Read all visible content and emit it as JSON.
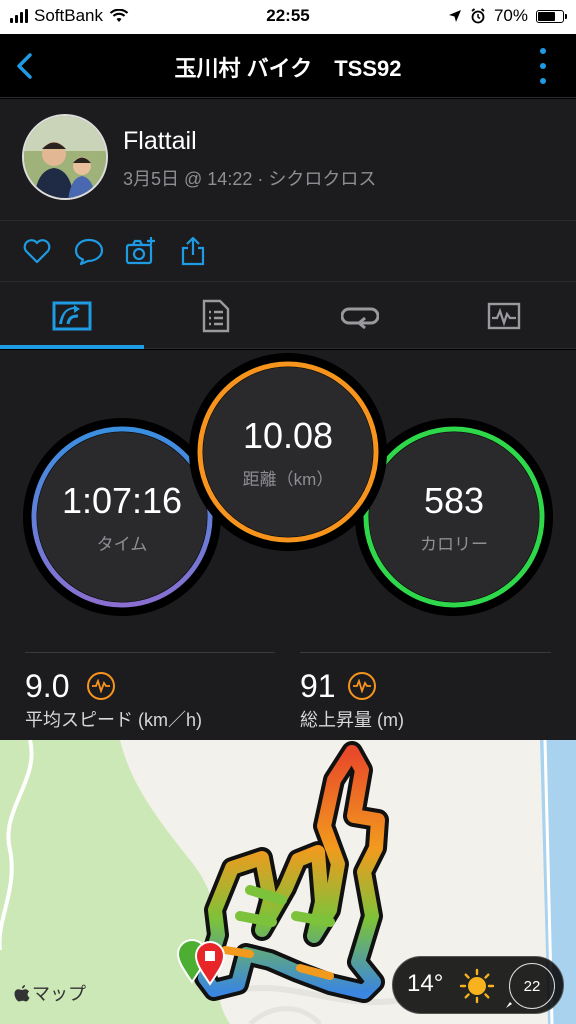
{
  "status_bar": {
    "carrier": "SoftBank",
    "time": "22:55",
    "battery": "70%",
    "battery_level": 0.7
  },
  "navbar": {
    "title": "玉川村 バイク　TSS92"
  },
  "profile": {
    "name": "Flattail",
    "subtitle": "3月5日 @ 14:22 · シクロクロス"
  },
  "actions": [
    "like-icon",
    "comment-icon",
    "add-photo-icon",
    "share-icon"
  ],
  "tabs": [
    {
      "icon": "stats-tab-icon",
      "active": true
    },
    {
      "icon": "details-tab-icon",
      "active": false
    },
    {
      "icon": "laps-tab-icon",
      "active": false
    },
    {
      "icon": "graphs-tab-icon",
      "active": false
    }
  ],
  "stats": {
    "time": {
      "value": "1:07:16",
      "label": "タイム"
    },
    "distance": {
      "value": "10.08",
      "label": "距離（km）"
    },
    "calories": {
      "value": "583",
      "label": "カロリー"
    },
    "avg_speed": {
      "value": "9.0",
      "label": "平均スピード (km／h)"
    },
    "elevation_gain": {
      "value": "91",
      "label": "総上昇量 (m)"
    }
  },
  "colors": {
    "accent": "#1e9be2",
    "time_ring_top": "#3a8fe0",
    "time_ring_bottom": "#8a6fd0",
    "distance_ring": "#f7941d",
    "calories_ring": "#2fd84a",
    "map_bg": "#cde8b7"
  },
  "map": {
    "attribution": "マップ",
    "weather": {
      "temperature": "14°",
      "wind": "22"
    }
  }
}
